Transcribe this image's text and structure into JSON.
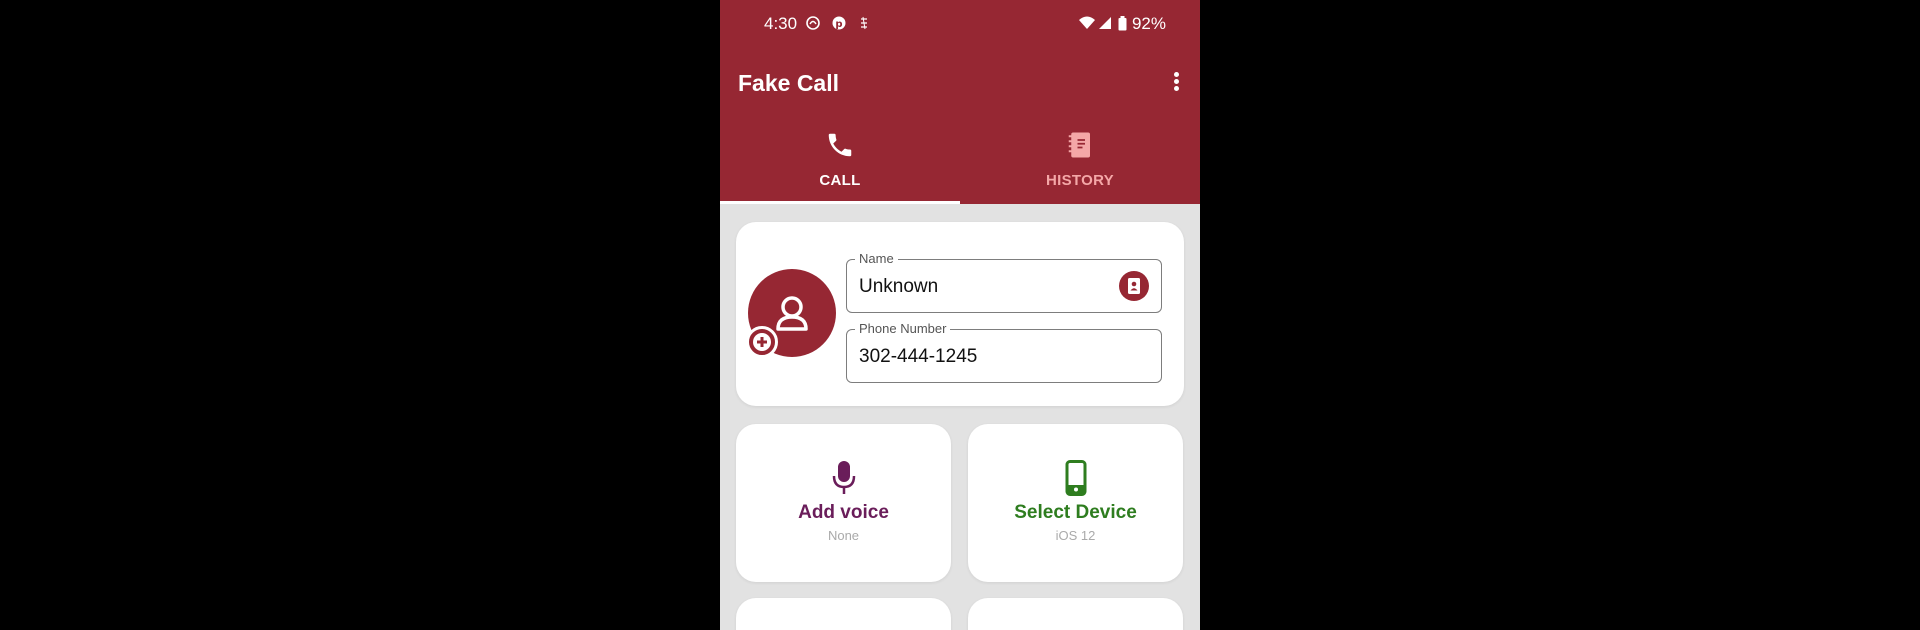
{
  "status_bar": {
    "time": "4:30",
    "battery": "92%"
  },
  "app": {
    "title": "Fake Call"
  },
  "tabs": [
    {
      "label": "CALL",
      "icon": "phone-icon",
      "active": true
    },
    {
      "label": "HISTORY",
      "icon": "notebook-icon",
      "active": false
    }
  ],
  "contact": {
    "name_label": "Name",
    "name_value": "Unknown",
    "phone_label": "Phone Number",
    "phone_value": "302-444-1245"
  },
  "tiles": [
    {
      "title": "Add voice",
      "subtitle": "None",
      "icon": "microphone-icon",
      "color": "#6a1d5a"
    },
    {
      "title": "Select Device",
      "subtitle": "iOS 12",
      "icon": "smartphone-icon",
      "color": "#2e7d1f"
    }
  ],
  "colors": {
    "primary": "#962733",
    "tab_inactive": "#f4a7a7",
    "background": "#e2e2e2"
  }
}
